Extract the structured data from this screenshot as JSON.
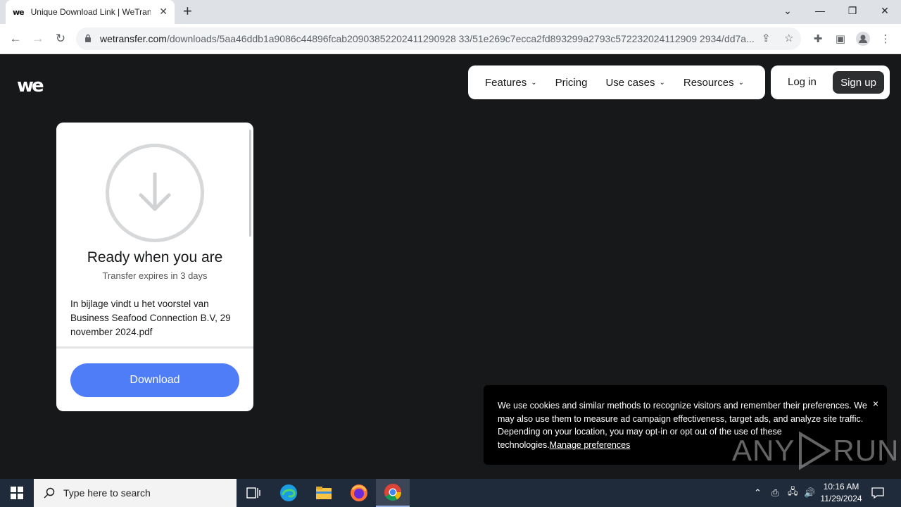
{
  "browser": {
    "tab_title": "Unique Download Link | WeTransfer",
    "tab_favicon": "we",
    "new_tab": "+",
    "url_host": "wetransfer.com",
    "url_path": "/downloads/5aa46ddb1a9086c44896fcab20903852202411290928 33/51e269c7ecca2fd893299a2793c572232024112909 2934/dd7a...",
    "window_controls": {
      "chevron": "⌄",
      "minimize": "—",
      "restore": "❐",
      "close": "✕"
    }
  },
  "page": {
    "logo": "we",
    "nav": [
      {
        "label": "Features",
        "dropdown": true
      },
      {
        "label": "Pricing",
        "dropdown": false
      },
      {
        "label": "Use cases",
        "dropdown": true
      },
      {
        "label": "Resources",
        "dropdown": true
      }
    ],
    "login": "Log in",
    "signup": "Sign up",
    "card": {
      "title": "Ready when you are",
      "expires": "Transfer expires in 3 days",
      "message": "In bijlage vindt u het voorstel van Business Seafood Connection B.V, 29 november 2024.pdf",
      "download": "Download"
    },
    "cookie": {
      "text": "We use cookies and similar methods to recognize visitors and remember their preferences. We may also use them to measure ad campaign effectiveness, target ads, and analyze site traffic. Depending on your location, you may opt-in or opt out of the use of these technologies.",
      "link": "Manage preferences",
      "close": "×"
    },
    "watermark_left": "ANY",
    "watermark_right": "RUN"
  },
  "taskbar": {
    "search_placeholder": "Type here to search",
    "time": "10:16 AM",
    "date": "11/29/2024"
  },
  "colors": {
    "page_bg": "#17181a",
    "download_button": "#4f7cf7",
    "taskbar_bg": "#1f2a3a"
  }
}
